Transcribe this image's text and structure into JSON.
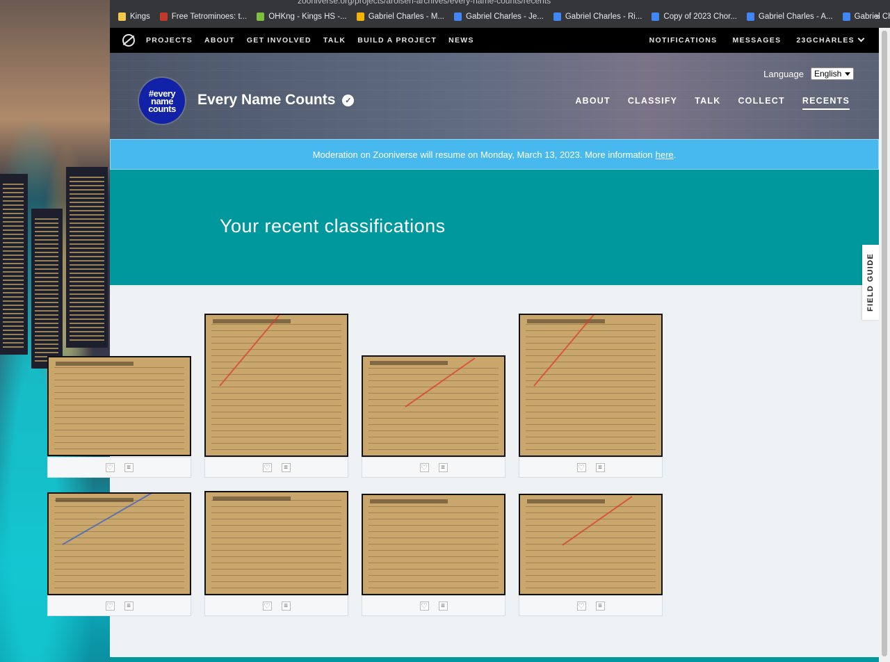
{
  "browser": {
    "url_fragment": "zooniverse.org/projects/arolsen-archives/every-name-counts/recents",
    "bookmarks": [
      {
        "label": "Kings",
        "icon": "folder-icon",
        "color": "#f2c94c"
      },
      {
        "label": "Free Tetrominoes: t...",
        "icon": "tetris-icon",
        "color": "#c0392b"
      },
      {
        "label": "OHKng - Kings HS -...",
        "icon": "plant-icon",
        "color": "#7fbf3f"
      },
      {
        "label": "Gabriel Charles - M...",
        "icon": "slides-icon",
        "color": "#f4b400"
      },
      {
        "label": "Gabriel Charles - Je...",
        "icon": "doc-icon",
        "color": "#4285f4"
      },
      {
        "label": "Gabriel Charles - Ri...",
        "icon": "doc-icon",
        "color": "#4285f4"
      },
      {
        "label": "Copy of 2023 Chor...",
        "icon": "doc-icon",
        "color": "#4285f4"
      },
      {
        "label": "Gabriel Charles - A...",
        "icon": "doc-icon",
        "color": "#4285f4"
      },
      {
        "label": "Gabriel Charles - A...",
        "icon": "doc-icon",
        "color": "#4285f4"
      }
    ],
    "more": "»"
  },
  "zoo_nav": {
    "left": [
      "PROJECTS",
      "ABOUT",
      "GET INVOLVED",
      "TALK",
      "BUILD A PROJECT",
      "NEWS"
    ],
    "right": [
      "NOTIFICATIONS",
      "MESSAGES",
      "23GCHARLES"
    ]
  },
  "project": {
    "language_label": "Language",
    "language_value": "English",
    "logo_text": "#every name counts",
    "title": "Every Name Counts",
    "nav": [
      "ABOUT",
      "CLASSIFY",
      "TALK",
      "COLLECT",
      "RECENTS"
    ],
    "active_nav": "RECENTS"
  },
  "banner": {
    "text": "Moderation on Zooniverse will resume on Monday, March 13, 2023. More information",
    "link": "here",
    "suffix": "."
  },
  "recents": {
    "heading": "Your recent classifications"
  },
  "field_guide": "FIELD GUIDE",
  "colors": {
    "teal": "#00979d",
    "banner": "#48b9ee",
    "logo": "#1122a8"
  }
}
